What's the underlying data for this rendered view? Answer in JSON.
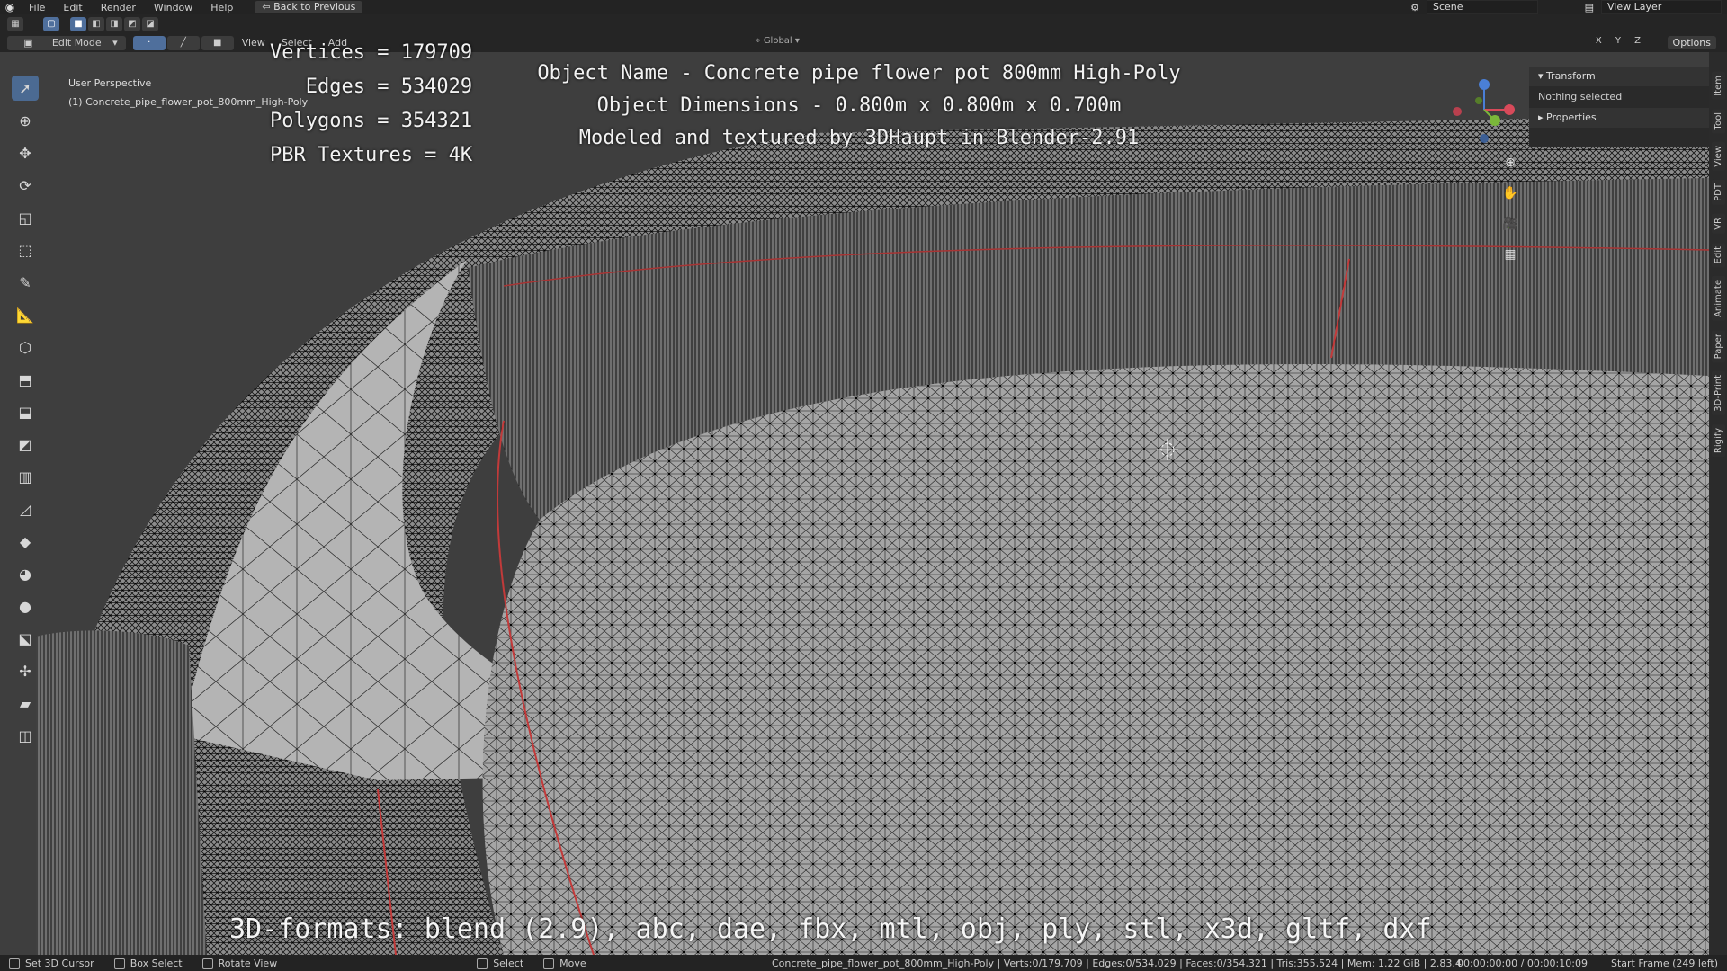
{
  "topbar": {
    "menu": [
      "File",
      "Edit",
      "Render",
      "Window",
      "Help"
    ],
    "back_label": "Back to Previous",
    "scene_label": "Scene",
    "view_layer_label": "View Layer"
  },
  "header": {
    "mode_label": "Edit Mode",
    "menu": [
      "View",
      "Select",
      "Add"
    ],
    "orientation_label": "Global",
    "axes_label": "X Y Z",
    "options_label": "Options"
  },
  "viewport": {
    "perspective_label": "User Perspective",
    "object_label": "(1) Concrete_pipe_flower_pot_800mm_High-Poly"
  },
  "overlay": {
    "title_lines": [
      "Object Name - Concrete pipe flower pot 800mm High-Poly",
      "Object Dimensions -  0.800m x 0.800m x 0.700m",
      "Modeled and textured by 3DHaupt in Blender-2.91"
    ],
    "stats": [
      "Vertices = 179709",
      "Edges = 534029",
      "Polygons = 354321",
      "PBR Textures = 4K"
    ],
    "formats": "3D-formats: blend (2.9), abc, dae, fbx, mtl, obj, ply, stl, x3d, gltf, dxf"
  },
  "npanel": {
    "transform_label": "Transform",
    "selection_text": "Nothing selected",
    "properties_label": "Properties",
    "tabs": [
      "Item",
      "Tool",
      "View",
      "PDT",
      "VR",
      "Edit",
      "Animate",
      "Paper",
      "3D-Print",
      "Rigify"
    ]
  },
  "statusbar": {
    "left_items": [
      "Set 3D Cursor",
      "Box Select",
      "Rotate View"
    ],
    "mid_items": [
      "Select",
      "Move"
    ],
    "scene_stats": "Concrete_pipe_flower_pot_800mm_High-Poly | Verts:0/179,709 | Edges:0/534,029 | Faces:0/354,321 | Tris:355,524 | Mem: 1.22 GiB | 2.83.4",
    "time": "00:00:00:00 / 00:00:10:09",
    "frame": "Start Frame (249 left)"
  },
  "colors": {
    "accent": "#4b6a92",
    "mesh_surface": "#9a9a9a",
    "wire": "#111111",
    "seam": "#c23a3a"
  }
}
